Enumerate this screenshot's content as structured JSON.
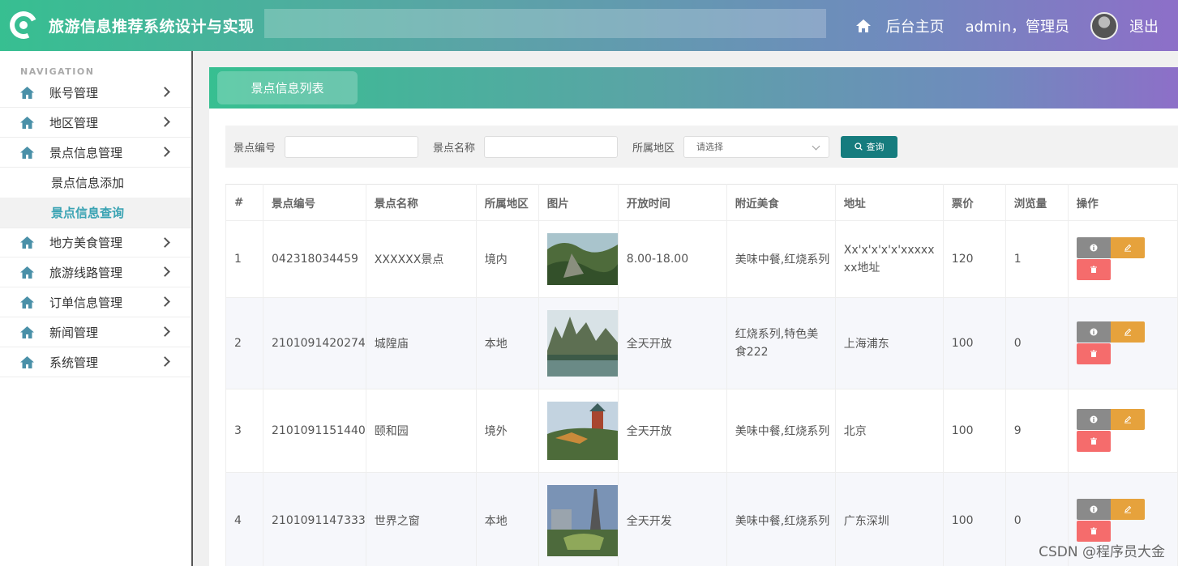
{
  "header": {
    "app_title": "旅游信息推荐系统设计与实现",
    "home_link": "后台主页",
    "user": "admin，管理员",
    "logout": "退出"
  },
  "sidebar": {
    "caption": "NAVIGATION",
    "items": [
      {
        "label": "账号管理"
      },
      {
        "label": "地区管理"
      },
      {
        "label": "景点信息管理"
      },
      {
        "label": "地方美食管理"
      },
      {
        "label": "旅游线路管理"
      },
      {
        "label": "订单信息管理"
      },
      {
        "label": "新闻管理"
      },
      {
        "label": "系统管理"
      }
    ],
    "sub_items": [
      {
        "label": "景点信息添加"
      },
      {
        "label": "景点信息查询"
      }
    ]
  },
  "main": {
    "tab_label": "景点信息列表"
  },
  "filter": {
    "code_label": "景点编号",
    "code_value": "",
    "name_label": "景点名称",
    "name_value": "",
    "region_label": "所属地区",
    "region_placeholder": "请选择",
    "search_label": "查询"
  },
  "table": {
    "headers": [
      "#",
      "景点编号",
      "景点名称",
      "所属地区",
      "图片",
      "开放时间",
      "附近美食",
      "地址",
      "票价",
      "浏览量",
      "操作"
    ],
    "rows": [
      {
        "index": "1",
        "code": "042318034459",
        "name": "XXXXXX景点",
        "region": "境内",
        "hours": "8.00-18.00",
        "food": "美味中餐,红烧系列",
        "address": "Xx'x'x'x'x'xxxxxxx地址",
        "price": "120",
        "views": "1"
      },
      {
        "index": "2",
        "code": "2101091420274",
        "name": "城隍庙",
        "region": "本地",
        "hours": "全天开放",
        "food": "红烧系列,特色美食222",
        "address": "上海浦东",
        "price": "100",
        "views": "0"
      },
      {
        "index": "3",
        "code": "2101091151440",
        "name": "颐和园",
        "region": "境外",
        "hours": "全天开放",
        "food": "美味中餐,红烧系列",
        "address": "北京",
        "price": "100",
        "views": "9"
      },
      {
        "index": "4",
        "code": "2101091147333",
        "name": "世界之窗",
        "region": "本地",
        "hours": "全天开发",
        "food": "美味中餐,红烧系列",
        "address": "广东深圳",
        "price": "100",
        "views": "0"
      }
    ]
  },
  "watermark": "CSDN @程序员大金",
  "colors": {
    "accent_green": "#37bf91",
    "accent_purple": "#8d6fc8",
    "search_button": "#167c7e",
    "info_button": "#8a8a8a",
    "edit_button": "#e6a23c",
    "delete_button": "#f56c6c",
    "active_nav": "#3aa3b3"
  },
  "icons": {
    "logo": "logo-ring-icon",
    "home": "home-icon",
    "nav": "house-icon",
    "search": "search-icon",
    "info": "info-icon",
    "edit": "pencil-icon",
    "delete": "trash-icon"
  }
}
